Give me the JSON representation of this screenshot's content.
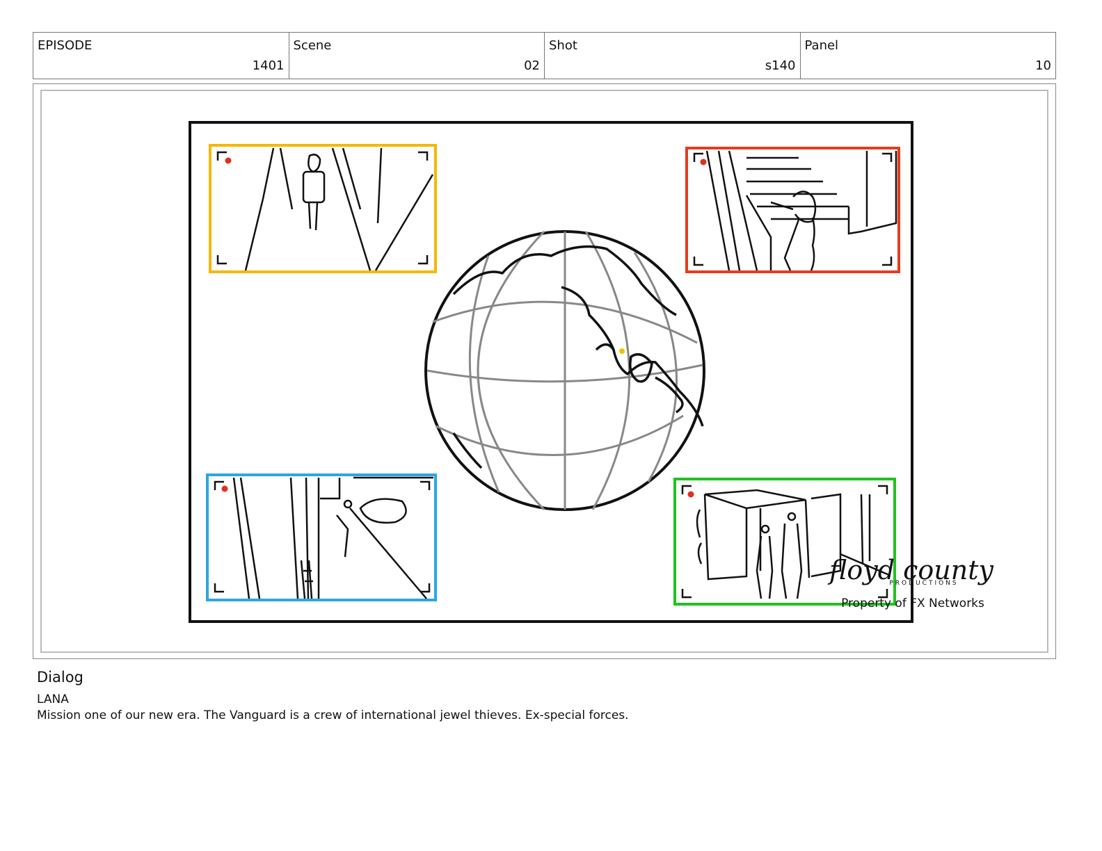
{
  "header": {
    "episode": {
      "label": "EPISODE",
      "value": "1401"
    },
    "scene": {
      "label": "Scene",
      "value": "02"
    },
    "shot": {
      "label": "Shot",
      "value": "s140"
    },
    "panel": {
      "label": "Panel",
      "value": "10"
    }
  },
  "panel_art": {
    "monitor_colors": {
      "top_left": "#f5b800",
      "top_right": "#e63c1e",
      "bottom_left": "#2aa8e0",
      "bottom_right": "#1ec41e"
    },
    "record_dot_color": "#e0301e",
    "globe_marker_color": "#f2c200"
  },
  "watermark": {
    "script": "floyd county",
    "sub": "PRODUCTIONS",
    "ownership": "Property of FX Networks"
  },
  "dialog": {
    "heading": "Dialog",
    "character": "LANA",
    "line": "Mission one of our new era. The Vanguard is a crew of international jewel thieves. Ex-special forces."
  }
}
